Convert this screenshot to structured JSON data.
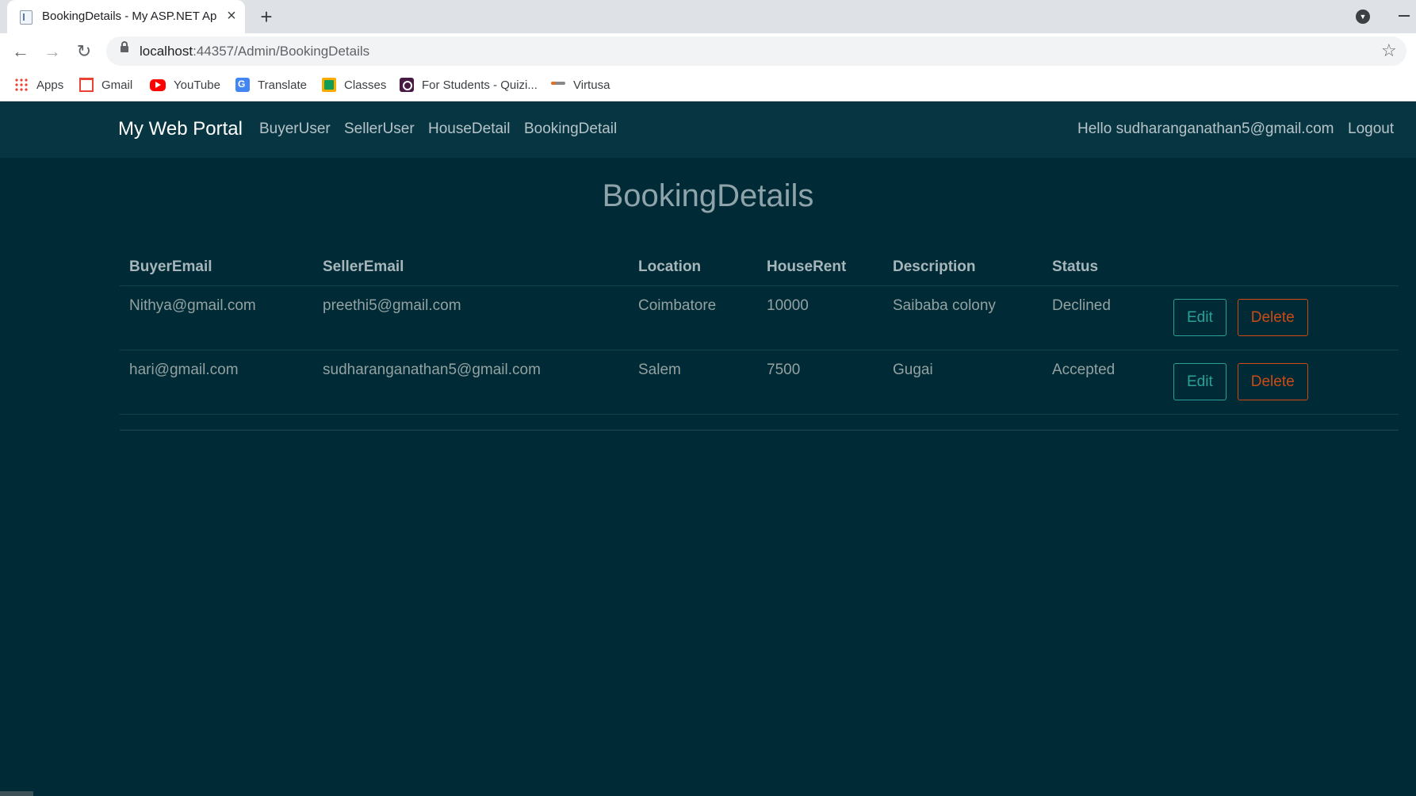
{
  "browser": {
    "tab_title": "BookingDetails - My ASP.NET Ap",
    "url_host": "localhost",
    "url_rest": ":44357/Admin/BookingDetails",
    "bookmarks": [
      "Apps",
      "Gmail",
      "YouTube",
      "Translate",
      "Classes",
      "For Students - Quizi...",
      "Virtusa"
    ]
  },
  "navbar": {
    "brand": "My Web Portal",
    "links": [
      "BuyerUser",
      "SellerUser",
      "HouseDetail",
      "BookingDetail"
    ],
    "greeting": "Hello sudharanganathan5@gmail.com",
    "logout": "Logout"
  },
  "page": {
    "title": "BookingDetails"
  },
  "table": {
    "headers": [
      "BuyerEmail",
      "SellerEmail",
      "Location",
      "HouseRent",
      "Description",
      "Status"
    ],
    "rows": [
      {
        "buyer_email": "Nithya@gmail.com",
        "seller_email": "preethi5@gmail.com",
        "location": "Coimbatore",
        "house_rent": "10000",
        "description": "Saibaba colony",
        "status": "Declined",
        "edit_label": "Edit",
        "delete_label": "Delete"
      },
      {
        "buyer_email": "hari@gmail.com",
        "seller_email": "sudharanganathan5@gmail.com",
        "location": "Salem",
        "house_rent": "7500",
        "description": "Gugai",
        "status": "Accepted",
        "edit_label": "Edit",
        "delete_label": "Delete"
      }
    ]
  },
  "colors": {
    "page_bg": "#002b36",
    "navbar_bg": "#073642",
    "edit_accent": "#2aa198",
    "delete_accent": "#cb4b16"
  }
}
